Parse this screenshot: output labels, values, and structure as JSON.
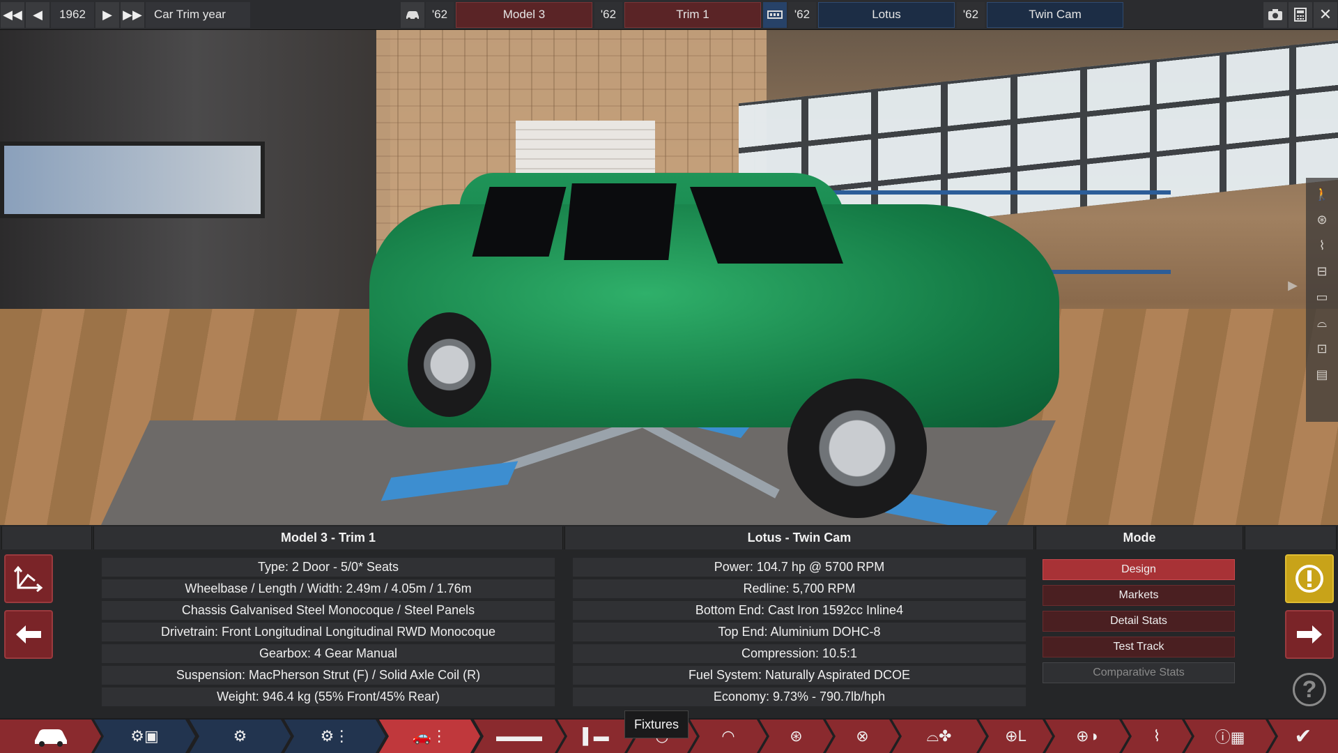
{
  "topbar": {
    "year_value": "1962",
    "trim_year_label": "Car Trim year",
    "model_year": "'62",
    "model_name": "Model 3",
    "trim_year": "'62",
    "trim_name": "Trim 1",
    "engine_family_year": "'62",
    "engine_family_name": "Lotus",
    "engine_variant_year": "'62",
    "engine_variant_name": "Twin Cam"
  },
  "car_panel": {
    "title": "Model 3 - Trim 1",
    "stats": [
      "Type: 2 Door - 5/0* Seats",
      "Wheelbase / Length / Width: 2.49m / 4.05m / 1.76m",
      "Chassis Galvanised Steel Monocoque / Steel Panels",
      "Drivetrain: Front Longitudinal Longitudinal RWD Monocoque",
      "Gearbox: 4 Gear Manual",
      "Suspension: MacPherson Strut (F) / Solid Axle Coil (R)",
      "Weight: 946.4 kg (55% Front/45% Rear)"
    ]
  },
  "engine_panel": {
    "title": "Lotus - Twin Cam",
    "stats": [
      "Power: 104.7 hp @ 5700 RPM",
      "Redline:  5,700 RPM",
      "Bottom End: Cast Iron 1592cc Inline4",
      "Top End: Aluminium DOHC-8",
      "Compression: 10.5:1",
      "Fuel System: Naturally Aspirated DCOE",
      "Economy: 9.73% - 790.7lb/hph"
    ]
  },
  "mode_panel": {
    "title": "Mode",
    "items": [
      "Design",
      "Markets",
      "Detail Stats",
      "Test Track",
      "Comparative Stats"
    ]
  },
  "tooltip": "Fixtures",
  "colors": {
    "accent_red": "#c0383c",
    "accent_blue": "#22344f",
    "warning_yellow": "#c8a319"
  }
}
